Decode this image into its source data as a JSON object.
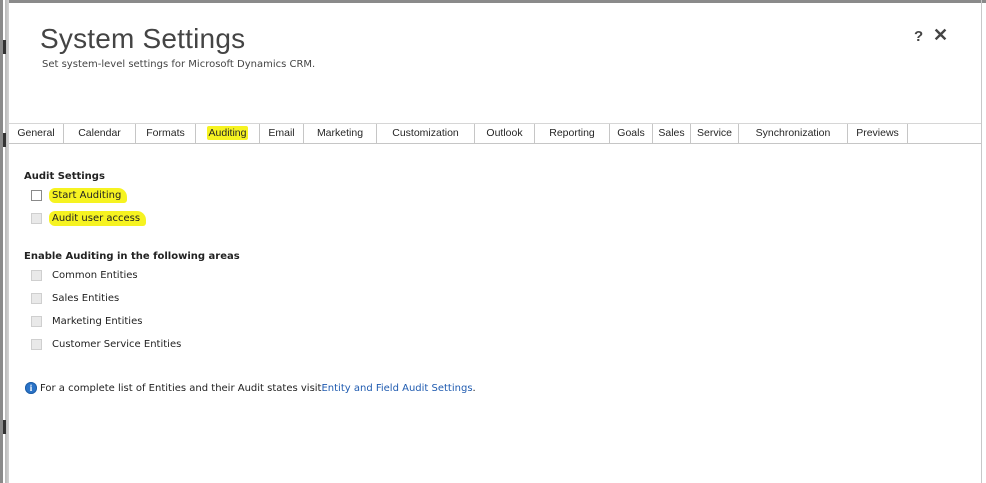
{
  "dialog": {
    "title": "System Settings",
    "subtitle": "Set system-level settings for Microsoft Dynamics CRM.",
    "help_label": "?",
    "close_label": "✕"
  },
  "tabs": [
    {
      "label": "General",
      "active": false
    },
    {
      "label": "Calendar",
      "active": false
    },
    {
      "label": "Formats",
      "active": false
    },
    {
      "label": "Auditing",
      "active": true
    },
    {
      "label": "Email",
      "active": false
    },
    {
      "label": "Marketing",
      "active": false
    },
    {
      "label": "Customization",
      "active": false
    },
    {
      "label": "Outlook",
      "active": false
    },
    {
      "label": "Reporting",
      "active": false
    },
    {
      "label": "Goals",
      "active": false
    },
    {
      "label": "Sales",
      "active": false
    },
    {
      "label": "Service",
      "active": false
    },
    {
      "label": "Synchronization",
      "active": false
    },
    {
      "label": "Previews",
      "active": false
    }
  ],
  "audit_settings": {
    "heading": "Audit Settings",
    "start_auditing": {
      "label": "Start Auditing",
      "checked": false,
      "enabled": true
    },
    "audit_user_access": {
      "label": "Audit user access",
      "checked": false,
      "enabled": false
    }
  },
  "areas": {
    "heading": "Enable Auditing in the following areas",
    "items": [
      {
        "label": "Common Entities",
        "checked": false,
        "enabled": false
      },
      {
        "label": "Sales Entities",
        "checked": false,
        "enabled": false
      },
      {
        "label": "Marketing Entities",
        "checked": false,
        "enabled": false
      },
      {
        "label": "Customer Service Entities",
        "checked": false,
        "enabled": false
      }
    ]
  },
  "info": {
    "text": "For a complete list of Entities and their Audit states visit ",
    "link": "Entity and Field Audit Settings",
    "suffix": "."
  },
  "colors": {
    "highlight": "#f6f321",
    "link": "#1f5bb0",
    "info_icon": "#2a73c8"
  },
  "icons": {
    "info": "info-icon",
    "help": "help-icon",
    "close": "close-icon"
  }
}
